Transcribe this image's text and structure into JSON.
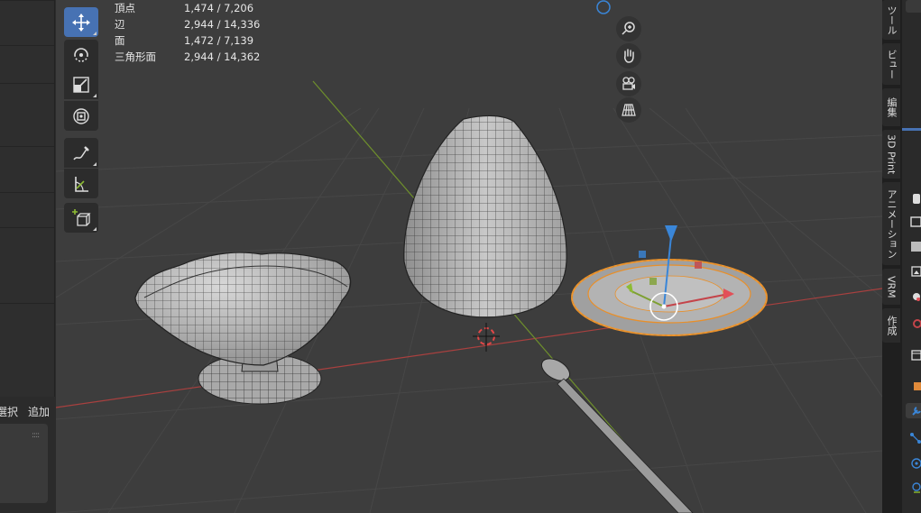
{
  "stats": [
    {
      "label": "頂点",
      "value": "1,474 / 7,206"
    },
    {
      "label": "辺",
      "value": "2,944 / 14,336"
    },
    {
      "label": "面",
      "value": "1,472 / 7,139"
    },
    {
      "label": "三角形面",
      "value": "2,944 / 14,362"
    }
  ],
  "left_panel": {
    "select_label": "選択",
    "add_label": "追加",
    "grip": "::::"
  },
  "toolbar": [
    {
      "name": "move-tool",
      "icon": "move-icon",
      "active": true
    },
    {
      "name": "rotate-tool",
      "icon": "rotate-icon",
      "active": false
    },
    {
      "name": "scale-tool",
      "icon": "scale-icon",
      "active": false
    },
    {
      "name": "transform-tool",
      "icon": "transform-icon",
      "active": false
    },
    {
      "name": "annotate-tool",
      "icon": "annotate-icon",
      "active": false
    },
    {
      "name": "measure-tool",
      "icon": "measure-icon",
      "active": false
    },
    {
      "name": "add-cube-tool",
      "icon": "add-cube-icon",
      "active": false
    }
  ],
  "nav_gizmo": [
    "zoom-icon",
    "pan-hand-icon",
    "camera-icon",
    "grid-perspective-icon"
  ],
  "sidebar_tabs": [
    {
      "label": "ツール"
    },
    {
      "label": "ビュー"
    },
    {
      "label": "編集"
    },
    {
      "label": "3D Print"
    },
    {
      "label": "アニメーション"
    },
    {
      "label": "VRM"
    },
    {
      "label": "作成"
    }
  ],
  "properties_icons": [
    "tool-icon",
    "render-icon",
    "output-icon",
    "view-layer-icon",
    "scene-icon",
    "world-icon",
    "collection-icon",
    "object-icon",
    "modifier-icon",
    "particles-icon",
    "physics-icon",
    "constraints-icon"
  ],
  "colors": {
    "accent": "#4772b3",
    "selection": "#f0962e",
    "x_axis": "#c4444a",
    "y_axis": "#7ea032",
    "z_axis": "#3a86d8"
  }
}
